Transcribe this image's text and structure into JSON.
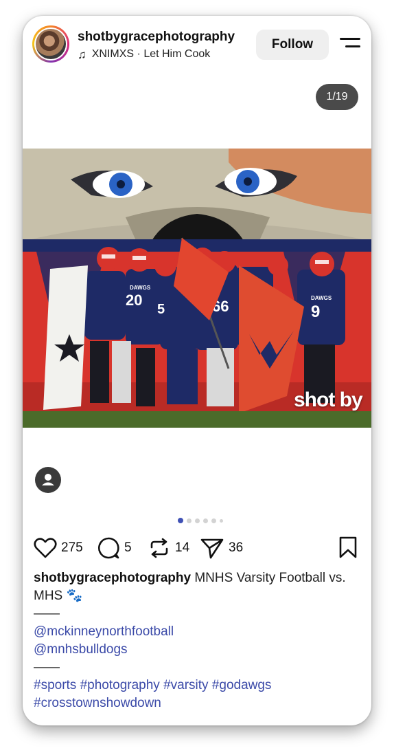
{
  "header": {
    "username": "shotbygracephotography",
    "music": "XNIMXS · Let Him Cook",
    "follow_label": "Follow",
    "icons": {
      "music": "music-note-icon",
      "menu": "menu-icon",
      "avatar": "avatar"
    }
  },
  "carousel": {
    "counter": "1/19",
    "dot_count": 6,
    "active_index": 0
  },
  "photo": {
    "watermark": "shot by",
    "jersey_numbers": [
      "20",
      "5",
      "66",
      "9"
    ],
    "jersey_lettering": "DAWGS",
    "colors": {
      "navy": "#1e2a66",
      "red": "#d8342c",
      "field": "#4b6b2a"
    }
  },
  "actions": {
    "likes": "275",
    "comments": "5",
    "reposts": "14",
    "shares": "36"
  },
  "caption": {
    "username": "shotbygracephotography",
    "text": "MNHS Varsity Football vs. MHS 🐾",
    "separator": "——",
    "mentions": [
      "@mckinneynorthfootball",
      "@mnhsbulldogs"
    ],
    "separator2": "——",
    "hashtags_line1": "#sports #photography #varsity #godawgs",
    "hashtags_line2": "#crosstownshowdown"
  },
  "colors": {
    "accent": "#3b4aa8",
    "button_bg": "#efefef",
    "counter_bg": "#4a4a4a"
  }
}
